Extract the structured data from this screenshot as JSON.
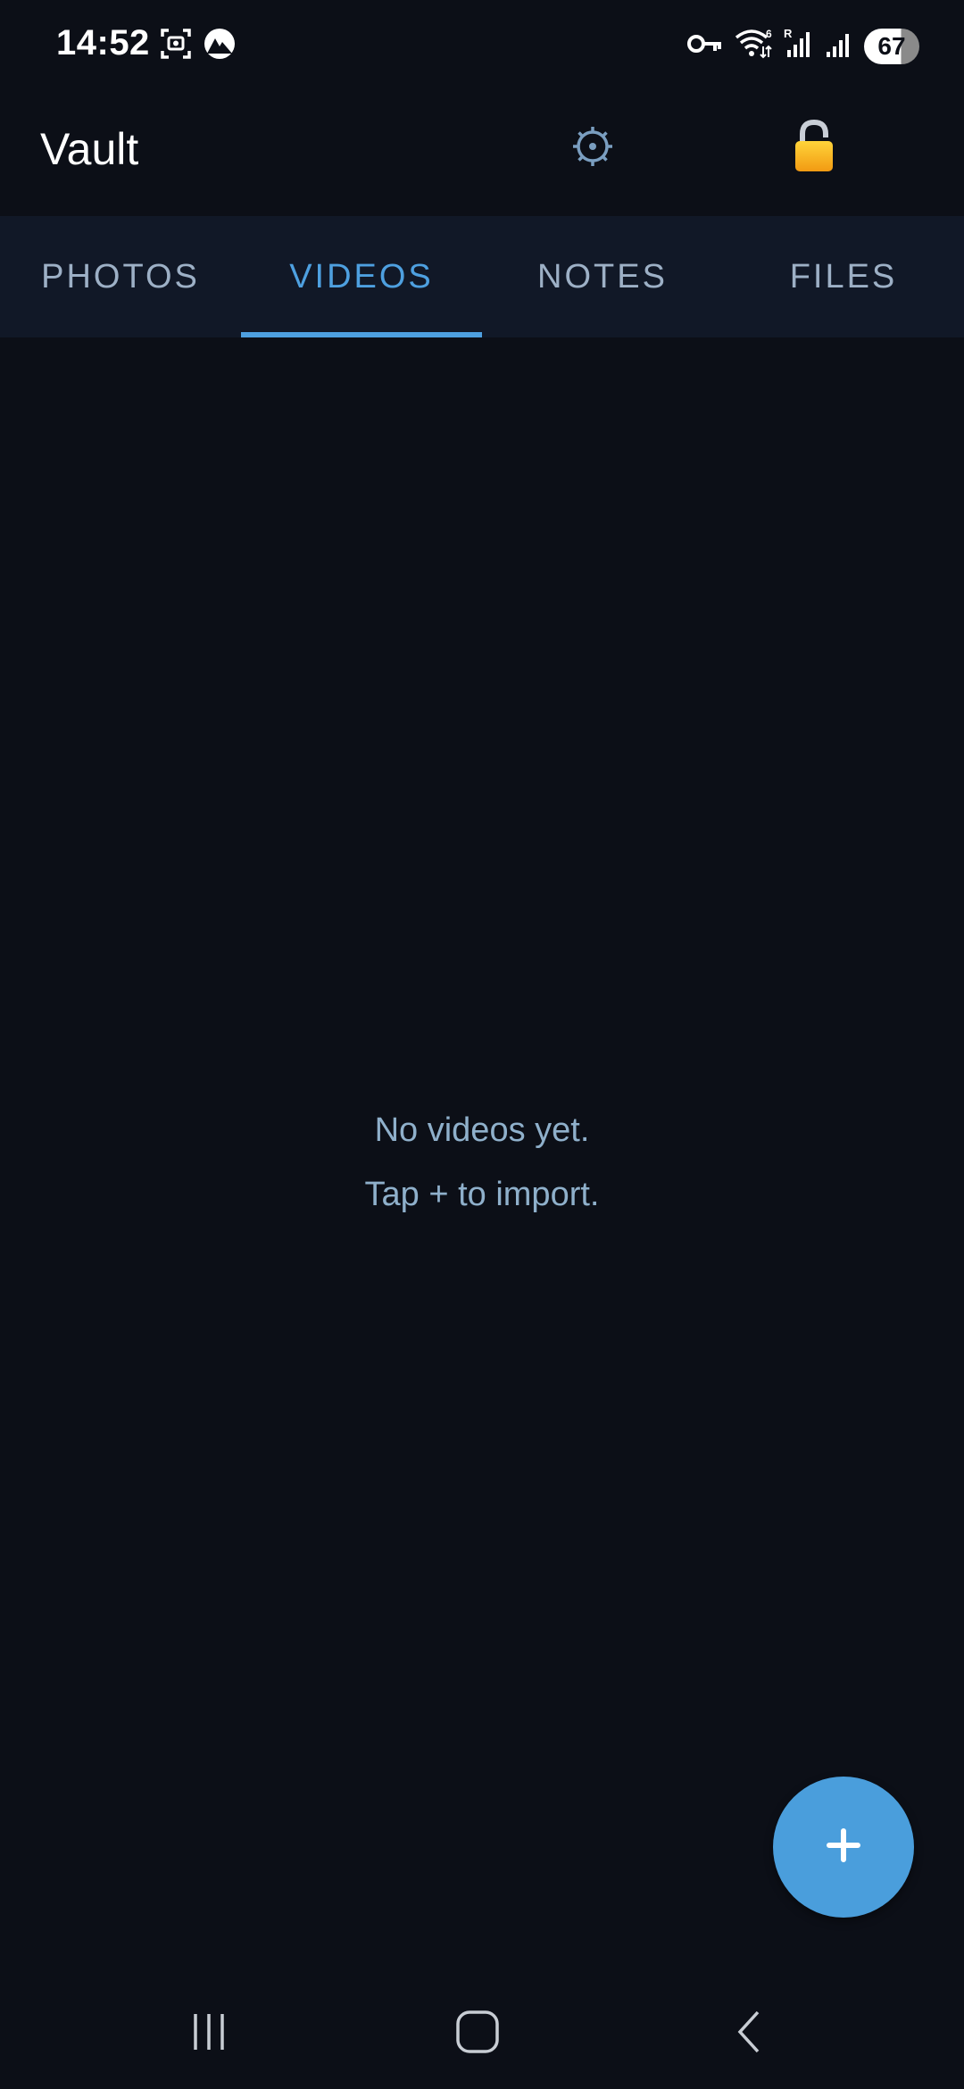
{
  "status_bar": {
    "time": "14:52",
    "battery_level": "67",
    "left_icons": [
      "screenshot-icon",
      "nordvpn-icon"
    ],
    "right_icons": [
      "vpn-key-icon",
      "wifi-icon",
      "signal-roaming-icon",
      "signal-icon",
      "battery-icon"
    ]
  },
  "app_bar": {
    "title": "Vault",
    "settings_icon": "settings-icon",
    "lock_icon": "lock-icon"
  },
  "tabs": [
    {
      "label": "PHOTOS",
      "active": false
    },
    {
      "label": "VIDEOS",
      "active": true
    },
    {
      "label": "NOTES",
      "active": false
    },
    {
      "label": "FILES",
      "active": false
    }
  ],
  "empty_state": {
    "line1": "No videos yet.",
    "line2": "Tap + to import."
  },
  "fab": {
    "icon": "plus-icon"
  },
  "nav_bar": {
    "recents_icon": "recents-icon",
    "home_icon": "home-icon",
    "back_icon": "back-icon"
  },
  "colors": {
    "background": "#0c0f17",
    "tab_bar": "#111827",
    "accent": "#4ea0e0",
    "fab": "#4a9edc",
    "muted_text": "#8fb0cb"
  }
}
